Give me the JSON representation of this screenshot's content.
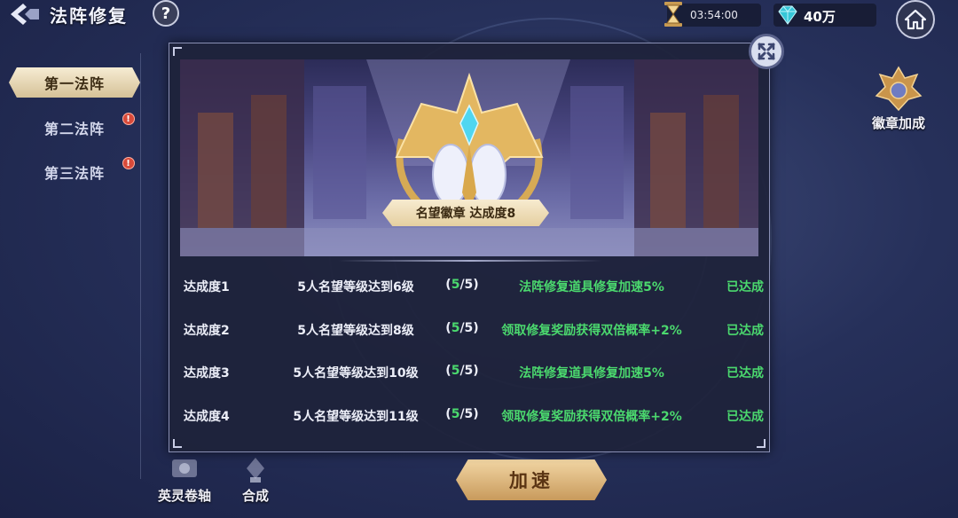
{
  "header": {
    "title": "法阵修复",
    "help_label": "?",
    "timer": "03:54:00",
    "currency": "40万",
    "icons": {
      "back": "back-arrow-icon",
      "help": "question-icon",
      "timer": "hourglass-icon",
      "gem": "diamond-icon",
      "home": "home-icon"
    }
  },
  "sidebar": {
    "tabs": [
      {
        "label": "第一法阵",
        "active": true,
        "alert": false
      },
      {
        "label": "第二法阵",
        "active": false,
        "alert": true
      },
      {
        "label": "第三法阵",
        "active": false,
        "alert": true
      }
    ],
    "alert_mark": "!"
  },
  "right": {
    "badge_label": "徽章加成"
  },
  "bottom": {
    "scroll_label": "英灵卷轴",
    "merge_label": "合成",
    "speed_label": "加速"
  },
  "panel": {
    "badge_title": "名望徽章 达成度8",
    "rows": [
      {
        "level": "达成度1",
        "requirement": "5人名望等级达到6级",
        "progress_open": "(",
        "progress_current": "5",
        "progress_total": "/5)",
        "effect": "法阵修复道具修复加速5%",
        "status": "已达成"
      },
      {
        "level": "达成度2",
        "requirement": "5人名望等级达到8级",
        "progress_open": "(",
        "progress_current": "5",
        "progress_total": "/5)",
        "effect": "领取修复奖励获得双倍概率+2%",
        "status": "已达成"
      },
      {
        "level": "达成度3",
        "requirement": "5人名望等级达到10级",
        "progress_open": "(",
        "progress_current": "5",
        "progress_total": "/5)",
        "effect": "法阵修复道具修复加速5%",
        "status": "已达成"
      },
      {
        "level": "达成度4",
        "requirement": "5人名望等级达到11级",
        "progress_open": "(",
        "progress_current": "5",
        "progress_total": "/5)",
        "effect": "领取修复奖励获得双倍概率+2%",
        "status": "已达成"
      }
    ]
  },
  "colors": {
    "accent_green": "#4bd96e",
    "tab_active": "#f6ecd3",
    "speed_button": "#e0b87a",
    "alert": "#d84a3a"
  }
}
